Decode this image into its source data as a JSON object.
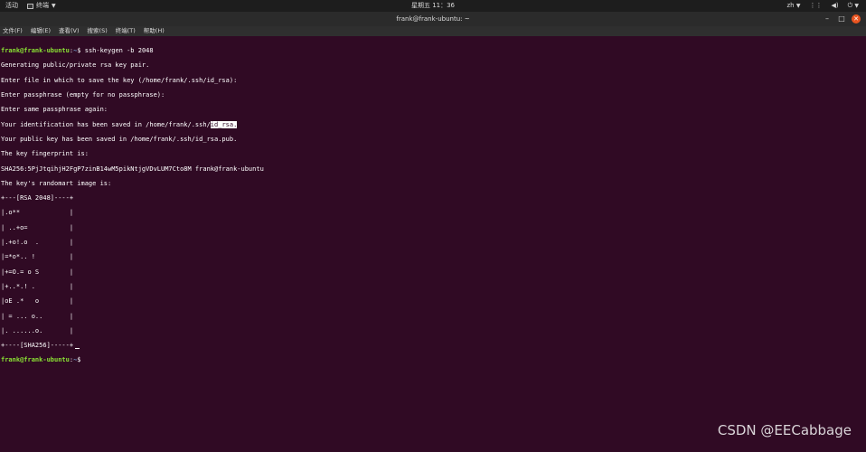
{
  "topbar": {
    "activities": "活动",
    "app_name": "终端",
    "clock": "星期五 11：36",
    "lang": "zh"
  },
  "window": {
    "title": "frank@frank-ubuntu: ~"
  },
  "menu": [
    {
      "label": "文件(F)"
    },
    {
      "label": "编辑(E)"
    },
    {
      "label": "查看(V)"
    },
    {
      "label": "搜索(S)"
    },
    {
      "label": "终端(T)"
    },
    {
      "label": "帮助(H)"
    }
  ],
  "terminal": {
    "prompt_user": "frank@frank-ubuntu",
    "prompt_path": "~",
    "command": "ssh-keygen -b 2048",
    "out1": "Generating public/private rsa key pair.",
    "out2": "Enter file in which to save the key (/home/frank/.ssh/id_rsa):",
    "out3": "Enter passphrase (empty for no passphrase):",
    "out4": "Enter same passphrase again:",
    "out5a": "Your identification has been saved in /home/frank/.ssh/",
    "out5b": "id_rsa.",
    "out6": "Your public key has been saved in /home/frank/.ssh/id_rsa.pub.",
    "out7": "The key fingerprint is:",
    "out8": "SHA256:5PjJtqihjH2FgP7zinB14wM5pikNtjgVDvLUM7Cto8M frank@frank-ubuntu",
    "out9": "The key's randomart image is:",
    "art": [
      "+---[RSA 2048]----+",
      "|.o**             |",
      "| ..+o=           |",
      "|.+o!.o  .        |",
      "|=*o*.. !         |",
      "|+=O.= o S        |",
      "|+..*.! .         |",
      "|oE .*   o        |",
      "| = ... o..       |",
      "|. ......o.       |",
      "+----[SHA256]-----+"
    ]
  },
  "watermark": "CSDN @EECabbage"
}
